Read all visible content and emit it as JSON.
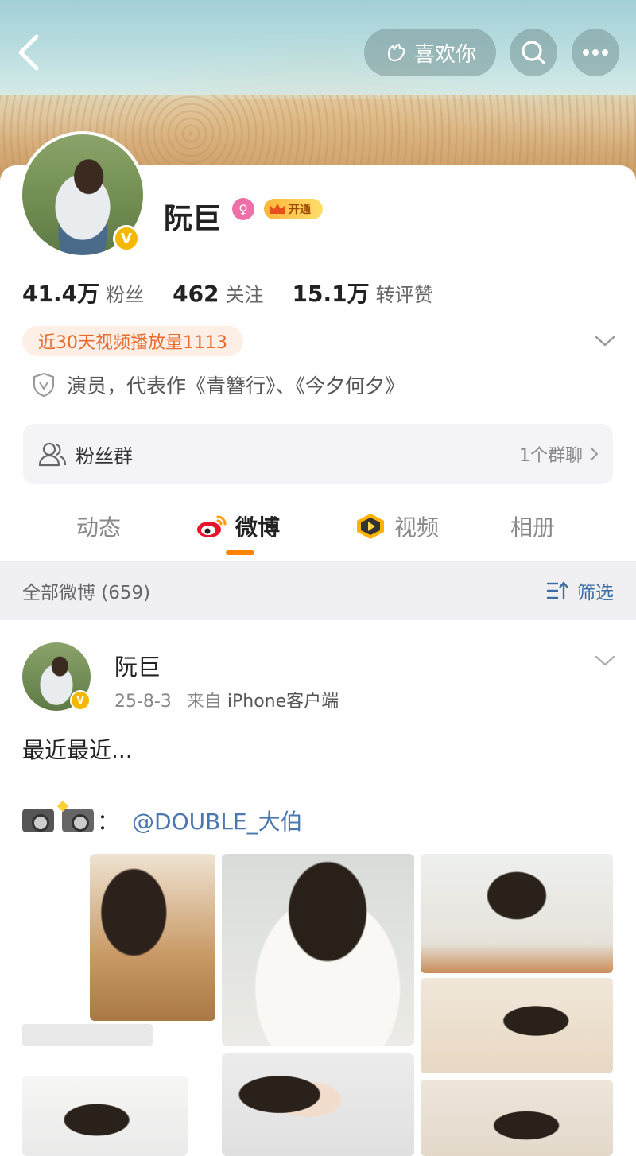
{
  "header": {
    "like_label": "喜欢你",
    "icons": {
      "back": "chevron-left-icon",
      "like": "like-hand-icon",
      "search": "search-icon",
      "more": "more-icon"
    }
  },
  "profile": {
    "name": "阮巨",
    "vip_label": "开通",
    "verified_mark": "V",
    "gender_mark": "♀",
    "stats": [
      {
        "num": "41.4万",
        "label": "粉丝"
      },
      {
        "num": "462",
        "label": "关注"
      },
      {
        "num": "15.1万",
        "label": "转评赞"
      }
    ],
    "play_tag": "近30天视频播放量1113",
    "bio": "演员，代表作《青簪行》、《今夕何夕》"
  },
  "fan_group": {
    "label": "粉丝群",
    "count": "1个群聊"
  },
  "tabs": [
    {
      "label": "动态"
    },
    {
      "label": "微博"
    },
    {
      "label": "视频"
    },
    {
      "label": "相册"
    }
  ],
  "filter_bar": {
    "total": "全部微博 (659)",
    "filter_label": "筛选"
  },
  "post": {
    "author": "阮巨",
    "date": "25-8-3",
    "source_prefix": "来自",
    "source": "iPhone客户端",
    "text": "最近最近...",
    "credit_mention": "@DOUBLE_大伯",
    "credit_sep": "："
  },
  "colors": {
    "accent": "#ff8200",
    "link": "#4b77b0",
    "vip": "#f5b800",
    "tag_bg": "#fdeee6",
    "tag_text": "#e86a2a"
  }
}
